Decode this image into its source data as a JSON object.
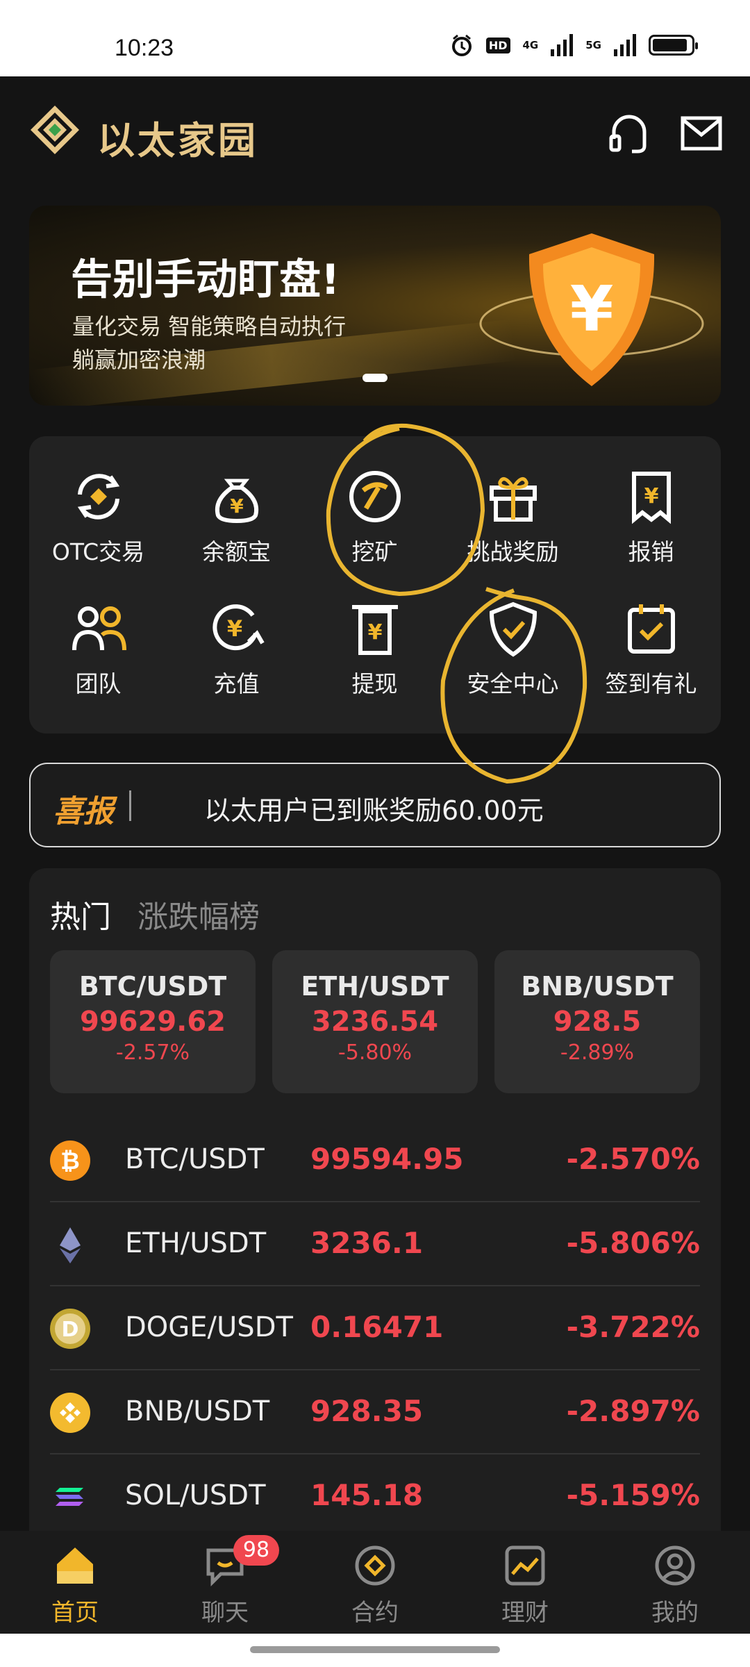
{
  "status_bar": {
    "time": "10:23",
    "hd_label": "HD",
    "net1": "4G",
    "net2": "5G",
    "battery_level": 0.9
  },
  "header": {
    "app_name": "以太家园",
    "support_icon": "headset-icon",
    "mail_icon": "mail-icon"
  },
  "banner": {
    "title": "告别手动盯盘!",
    "subtitle_line1": "量化交易 智能策略自动执行",
    "subtitle_line2": "躺赢加密浪潮",
    "shield_symbol": "¥"
  },
  "menu": {
    "items": [
      {
        "label": "OTC交易",
        "icon": "exchange-icon"
      },
      {
        "label": "余额宝",
        "icon": "money-bag-icon"
      },
      {
        "label": "挖矿",
        "icon": "pickaxe-icon"
      },
      {
        "label": "挑战奖励",
        "icon": "gift-icon"
      },
      {
        "label": "报销",
        "icon": "receipt-icon"
      },
      {
        "label": "团队",
        "icon": "team-icon"
      },
      {
        "label": "充值",
        "icon": "deposit-icon"
      },
      {
        "label": "提现",
        "icon": "withdraw-icon"
      },
      {
        "label": "安全中心",
        "icon": "shield-check-icon"
      },
      {
        "label": "签到有礼",
        "icon": "calendar-check-icon"
      }
    ]
  },
  "notice": {
    "tag": "喜报",
    "message": "以太用户已到账奖励60.00元"
  },
  "market": {
    "tabs": [
      "热门",
      "涨跌幅榜"
    ],
    "cards": [
      {
        "pair": "BTC/USDT",
        "price": "99629.62",
        "change": "-2.57%"
      },
      {
        "pair": "ETH/USDT",
        "price": "3236.54",
        "change": "-5.80%"
      },
      {
        "pair": "BNB/USDT",
        "price": "928.5",
        "change": "-2.89%"
      }
    ],
    "rows": [
      {
        "pair": "BTC/USDT",
        "price": "99594.95",
        "change": "-2.570%",
        "icon": "bitcoin-icon"
      },
      {
        "pair": "ETH/USDT",
        "price": "3236.1",
        "change": "-5.806%",
        "icon": "ethereum-icon"
      },
      {
        "pair": "DOGE/USDT",
        "price": "0.16471",
        "change": "-3.722%",
        "icon": "dogecoin-icon"
      },
      {
        "pair": "BNB/USDT",
        "price": "928.35",
        "change": "-2.897%",
        "icon": "bnb-icon"
      },
      {
        "pair": "SOL/USDT",
        "price": "145.18",
        "change": "-5.159%",
        "icon": "solana-icon"
      }
    ]
  },
  "bottom_nav": {
    "items": [
      {
        "label": "首页",
        "icon": "home-icon",
        "active": true
      },
      {
        "label": "聊天",
        "icon": "chat-icon",
        "badge": "98"
      },
      {
        "label": "合约",
        "icon": "contract-icon"
      },
      {
        "label": "理财",
        "icon": "finance-icon"
      },
      {
        "label": "我的",
        "icon": "profile-icon"
      }
    ]
  },
  "colors": {
    "accent": "#f1b62b",
    "down": "#f0474f",
    "brand": "#e7c88a",
    "annotation": "#e9b530"
  }
}
